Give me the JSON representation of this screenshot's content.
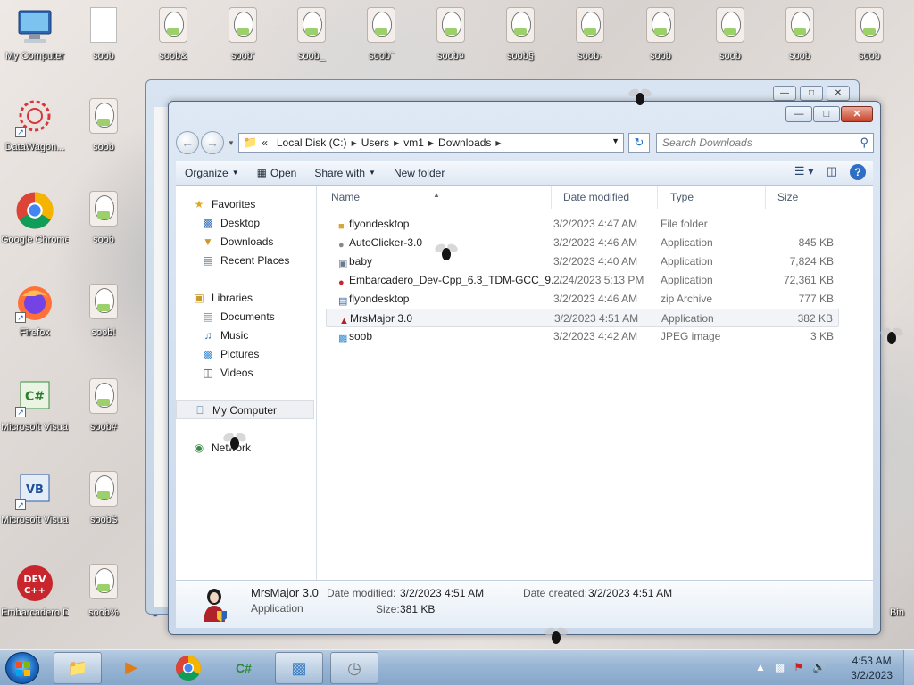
{
  "desktop": {
    "top_row": [
      {
        "label": "My Computer",
        "kind": "computer"
      },
      {
        "label": "soob",
        "kind": "doc"
      },
      {
        "label": "soob&",
        "kind": "soob"
      },
      {
        "label": "soob'",
        "kind": "soob"
      },
      {
        "label": "soob_",
        "kind": "soob"
      },
      {
        "label": "soob¨",
        "kind": "soob"
      },
      {
        "label": "soob¤",
        "kind": "soob"
      },
      {
        "label": "soob§",
        "kind": "soob"
      },
      {
        "label": "soob·",
        "kind": "soob"
      },
      {
        "label": "soob",
        "kind": "soob"
      },
      {
        "label": "soob",
        "kind": "soob"
      },
      {
        "label": "soob",
        "kind": "soob"
      },
      {
        "label": "soob",
        "kind": "soob"
      }
    ],
    "left_col": [
      {
        "label": "DataWagon...",
        "kind": "datawagon"
      },
      {
        "label": "Google Chrome",
        "kind": "chrome"
      },
      {
        "label": "Firefox",
        "kind": "firefox"
      },
      {
        "label": "Microsoft Visual C# ...",
        "kind": "csharp"
      },
      {
        "label": "Microsoft Visual Basi...",
        "kind": "vb"
      },
      {
        "label": "Embarcadero Dev-C++",
        "kind": "devcpp"
      }
    ],
    "second_col": [
      {
        "label": "soob"
      },
      {
        "label": "soob"
      },
      {
        "label": "soob!"
      },
      {
        "label": "soob#"
      },
      {
        "label": "soob$"
      },
      {
        "label": "soob%"
      }
    ],
    "partial_labels": {
      "left": "s",
      "right": "Bin"
    }
  },
  "explorer": {
    "breadcrumb": [
      "«",
      "Local Disk (C:)",
      "Users",
      "vm1",
      "Downloads"
    ],
    "search_placeholder": "Search Downloads",
    "toolbar": {
      "organize": "Organize",
      "open": "Open",
      "share_with": "Share with",
      "new_folder": "New folder"
    },
    "nav": {
      "favorites": "Favorites",
      "favorites_items": [
        "Desktop",
        "Downloads",
        "Recent Places"
      ],
      "libraries": "Libraries",
      "libraries_items": [
        "Documents",
        "Music",
        "Pictures",
        "Videos"
      ],
      "computer": "My Computer",
      "network": "Network"
    },
    "columns": {
      "name": "Name",
      "date": "Date modified",
      "type": "Type",
      "size": "Size"
    },
    "files": [
      {
        "name": "flyondesktop",
        "date": "3/2/2023 4:47 AM",
        "type": "File folder",
        "size": "",
        "icon": "folder-icon"
      },
      {
        "name": "AutoClicker-3.0",
        "date": "3/2/2023 4:46 AM",
        "type": "Application",
        "size": "845 KB",
        "icon": "mouse-icon"
      },
      {
        "name": "baby",
        "date": "3/2/2023 4:40 AM",
        "type": "Application",
        "size": "7,824 KB",
        "icon": "app-icon"
      },
      {
        "name": "Embarcadero_Dev-Cpp_6.3_TDM-GCC_9....",
        "date": "2/24/2023 5:13 PM",
        "type": "Application",
        "size": "72,361 KB",
        "icon": "devcpp-icon"
      },
      {
        "name": "flyondesktop",
        "date": "3/2/2023 4:46 AM",
        "type": "zip Archive",
        "size": "777 KB",
        "icon": "zip-icon"
      },
      {
        "name": "MrsMajor 3.0",
        "date": "3/2/2023 4:51 AM",
        "type": "Application",
        "size": "382 KB",
        "icon": "mrsmajor-icon"
      },
      {
        "name": "soob",
        "date": "3/2/2023 4:42 AM",
        "type": "JPEG image",
        "size": "3 KB",
        "icon": "image-icon"
      }
    ],
    "details": {
      "name": "MrsMajor 3.0",
      "type": "Application",
      "date_modified_label": "Date modified:",
      "date_modified": "3/2/2023 4:51 AM",
      "date_created_label": "Date created:",
      "date_created": "3/2/2023 4:51 AM",
      "size_label": "Size:",
      "size": "381 KB"
    }
  },
  "taskbar": {
    "clock_time": "4:53 AM",
    "clock_date": "3/2/2023"
  }
}
